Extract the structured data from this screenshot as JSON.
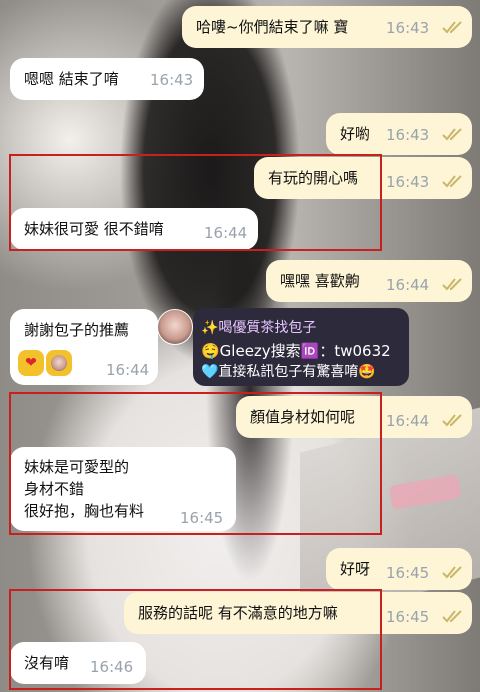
{
  "messages": [
    {
      "side": "out",
      "text": "哈嘍~你們結束了嘛 寶",
      "time": "16:43"
    },
    {
      "side": "in",
      "text": "嗯嗯 結束了唷",
      "time": "16:43"
    },
    {
      "side": "out",
      "text": "好喲",
      "time": "16:43"
    },
    {
      "side": "out",
      "text": "有玩的開心嗎",
      "time": "16:43"
    },
    {
      "side": "in",
      "text": "妹妹很可愛 很不錯唷",
      "time": "16:44"
    },
    {
      "side": "out",
      "text": "嘿嘿 喜歡齁",
      "time": "16:44"
    },
    {
      "side": "in",
      "text": "謝謝包子的推薦",
      "time": "16:44"
    },
    {
      "side": "out",
      "text": "顏值身材如何呢",
      "time": "16:44"
    },
    {
      "side": "in",
      "lines": [
        "妹妹是可愛型的",
        "身材不錯",
        "很好抱，胸也有料"
      ],
      "time": "16:45"
    },
    {
      "side": "out",
      "text": "好呀",
      "time": "16:45"
    },
    {
      "side": "out",
      "text": "服務的話呢 有不滿意的地方嘛",
      "time": "16:45"
    },
    {
      "side": "in",
      "text": "沒有唷",
      "time": "16:46"
    }
  ],
  "reactions": [
    "heart",
    "face"
  ],
  "reaction_glyph": "❤",
  "ad": {
    "line1": "✨喝優質茶找包子",
    "line2": "🤤Gleezy搜索🆔：tw0632",
    "line3": "🩵直接私訊包子有驚喜唷🤩"
  },
  "colors": {
    "incoming_bubble": "#ffffff",
    "outgoing_bubble": "#fdf5d6",
    "timestamp": "#9aa3ad",
    "read_check": "#c9b76a",
    "highlight_box": "#c8201c"
  },
  "icons": [
    "double-check-icon",
    "avatar",
    "heart-reaction-icon",
    "face-reaction-icon"
  ]
}
